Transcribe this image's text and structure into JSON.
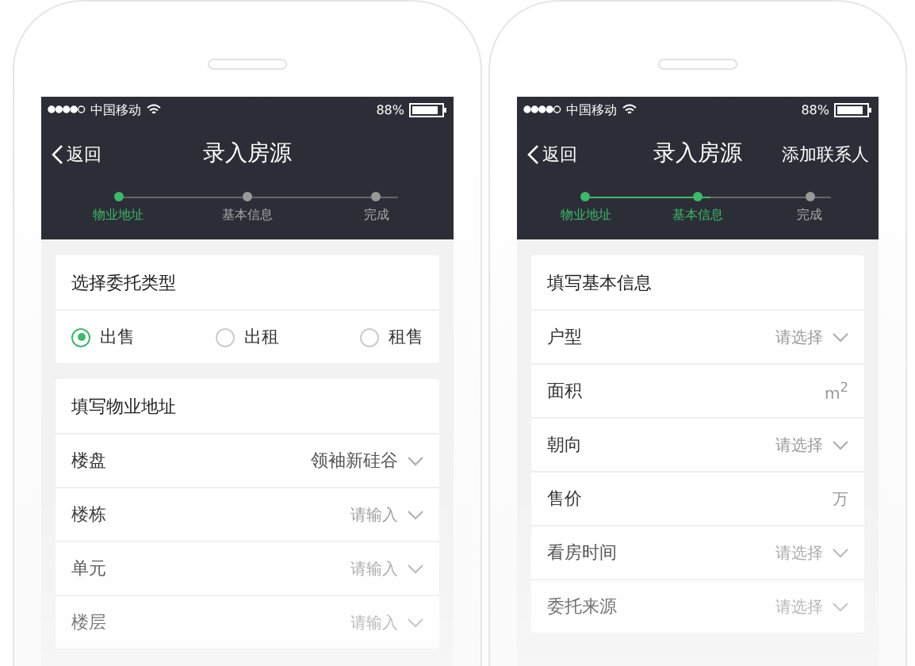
{
  "phones": [
    {
      "status": {
        "carrier": "中国移动",
        "battery": "88%"
      },
      "nav": {
        "back": "返回",
        "title": "录入房源"
      },
      "steps": [
        {
          "label": "物业地址",
          "done": true
        },
        {
          "label": "基本信息",
          "done": false
        },
        {
          "label": "完成",
          "done": false
        }
      ],
      "sections": [
        {
          "kind": "radio",
          "title": "选择委托类型",
          "options": [
            {
              "label": "出售",
              "selected": true
            },
            {
              "label": "出租",
              "selected": false
            },
            {
              "label": "租售",
              "selected": false
            }
          ]
        },
        {
          "kind": "form",
          "title": "填写物业地址",
          "rows": [
            {
              "label": "楼盘",
              "kind": "select",
              "value": "领袖新硅谷"
            },
            {
              "label": "楼栋",
              "kind": "select",
              "placeholder": "请输入"
            },
            {
              "label": "单元",
              "kind": "select",
              "placeholder": "请输入"
            },
            {
              "label": "楼层",
              "kind": "select",
              "placeholder": "请输入"
            }
          ]
        }
      ]
    },
    {
      "status": {
        "carrier": "中国移动",
        "battery": "88%"
      },
      "nav": {
        "back": "返回",
        "title": "录入房源",
        "action": "添加联系人"
      },
      "steps": [
        {
          "label": "物业地址",
          "done": true
        },
        {
          "label": "基本信息",
          "done": true
        },
        {
          "label": "完成",
          "done": false
        }
      ],
      "sections": [
        {
          "kind": "form",
          "title": "填写基本信息",
          "rows": [
            {
              "label": "户型",
              "kind": "select",
              "placeholder": "请选择"
            },
            {
              "label": "面积",
              "kind": "unit",
              "placeholder": "m$^{2}$"
            },
            {
              "label": "朝向",
              "kind": "select",
              "placeholder": "请选择"
            },
            {
              "label": "售价",
              "kind": "unit",
              "placeholder": "万"
            },
            {
              "label": "看房时间",
              "kind": "select",
              "placeholder": "请选择"
            },
            {
              "label": "委托来源",
              "kind": "select",
              "placeholder": "请选择"
            }
          ]
        }
      ]
    }
  ]
}
